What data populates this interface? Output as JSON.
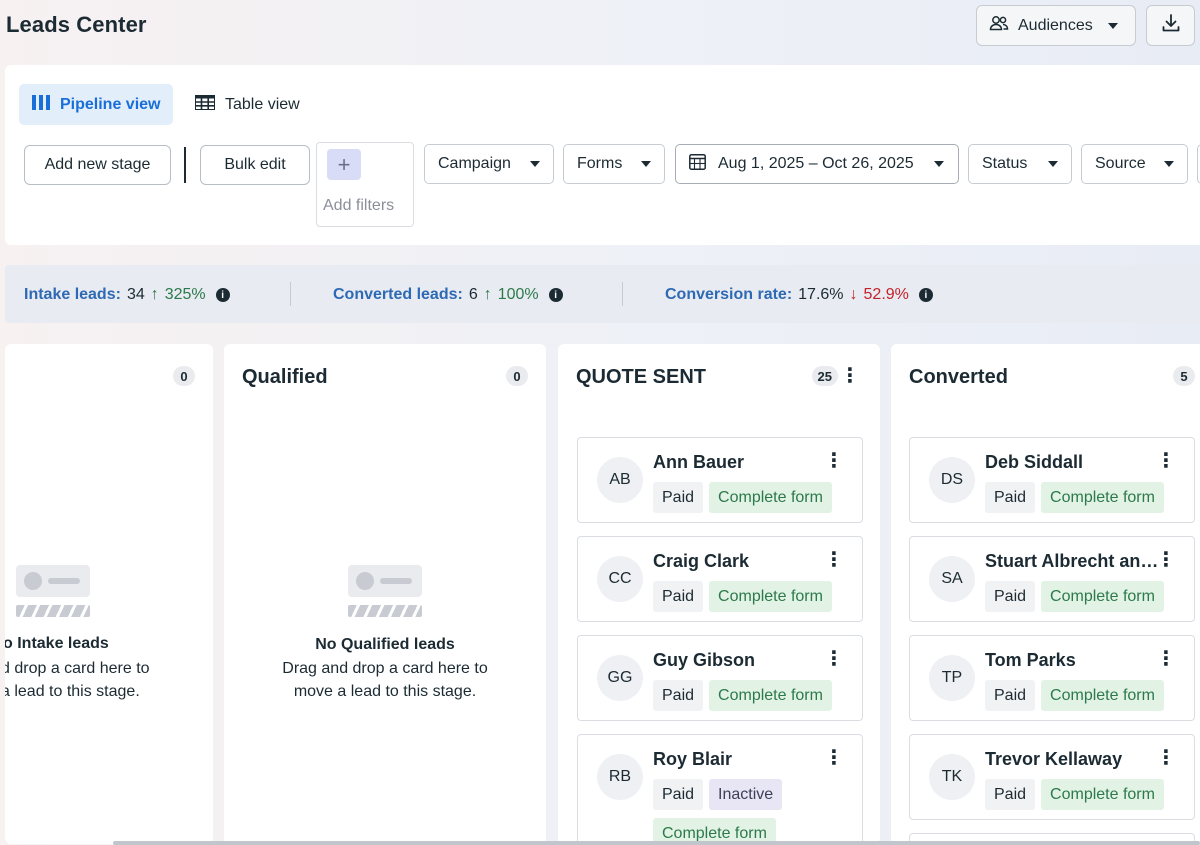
{
  "header": {
    "title": "Leads Center",
    "audiences_label": "Audiences"
  },
  "toolbar": {
    "views": [
      {
        "label": "Pipeline view",
        "active": true
      },
      {
        "label": "Table view",
        "active": false
      }
    ],
    "add_stage_label": "Add new stage",
    "bulk_edit_label": "Bulk edit",
    "add_filters_label": "Add filters",
    "filters": {
      "campaign": "Campaign",
      "forms": "Forms",
      "date_range": "Aug 1, 2025 – Oct 26, 2025",
      "status": "Status",
      "source": "Source"
    }
  },
  "metrics": {
    "intake": {
      "label": "Intake leads:",
      "value": "34",
      "change": "325%",
      "direction": "up"
    },
    "converted": {
      "label": "Converted leads:",
      "value": "6",
      "change": "100%",
      "direction": "up"
    },
    "conversion_rate": {
      "label": "Conversion rate:",
      "value": "17.6%",
      "change": "52.9%",
      "direction": "down"
    }
  },
  "columns": {
    "intake": {
      "count": "0",
      "empty_title": "o Intake leads",
      "empty_line1": "d drop a card here to",
      "empty_line2": "a lead to this stage."
    },
    "qualified": {
      "title": "Qualified",
      "count": "0",
      "empty_title": "No Qualified leads",
      "empty_line1": "Drag and drop a card here to",
      "empty_line2": "move a lead to this stage."
    },
    "quote_sent": {
      "title": "QUOTE SENT",
      "count": "25",
      "cards": [
        {
          "initials": "AB",
          "name": "Ann Bauer",
          "tags": [
            "Paid",
            "Complete form"
          ]
        },
        {
          "initials": "CC",
          "name": "Craig Clark",
          "tags": [
            "Paid",
            "Complete form"
          ]
        },
        {
          "initials": "GG",
          "name": "Guy Gibson",
          "tags": [
            "Paid",
            "Complete form"
          ]
        },
        {
          "initials": "RB",
          "name": "Roy Blair",
          "tags": [
            "Paid",
            "Inactive",
            "Complete form"
          ]
        }
      ]
    },
    "converted": {
      "title": "Converted",
      "count": "5",
      "cards": [
        {
          "initials": "DS",
          "name": "Deb Siddall",
          "tags": [
            "Paid",
            "Complete form"
          ]
        },
        {
          "initials": "SA",
          "name": "Stuart Albrecht an…",
          "tags": [
            "Paid",
            "Complete form"
          ]
        },
        {
          "initials": "TP",
          "name": "Tom Parks",
          "tags": [
            "Paid",
            "Complete form"
          ]
        },
        {
          "initials": "TK",
          "name": "Trevor Kellaway",
          "tags": [
            "Paid",
            "Complete form"
          ]
        }
      ]
    }
  },
  "colors": {
    "accent_blue": "#1a6ed8",
    "metric_label": "#2e6ab3",
    "positive": "#2c7a4b",
    "negative": "#c4222a",
    "complete_tag_bg": "#e2f2e5",
    "inactive_tag_bg": "#e8e6f4"
  },
  "icons": [
    "people-icon",
    "download-icon",
    "columns-icon",
    "table-icon",
    "plus-icon",
    "calendar-icon",
    "info-icon",
    "arrow-up-icon",
    "arrow-down-icon",
    "more-vertical-icon"
  ]
}
